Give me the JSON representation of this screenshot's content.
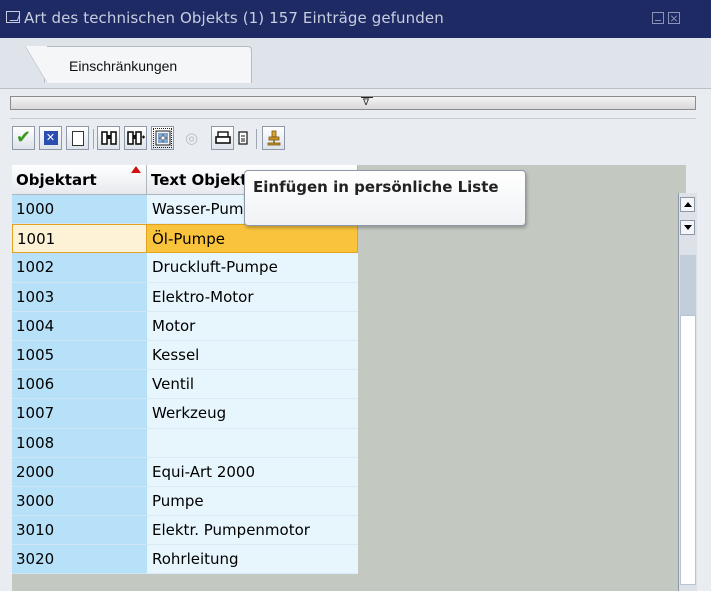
{
  "window": {
    "title": "Art des technischen Objekts (1)  157 Einträge gefunden",
    "title_icon": "window-icon",
    "minimize_icon": "minimize-icon",
    "close_icon": "close-icon"
  },
  "tabs": [
    {
      "label": "Einschränkungen",
      "active": true
    }
  ],
  "collapse_bar": {
    "icon": "collapse-arrow-icon",
    "glyph": "∇"
  },
  "toolbar": {
    "buttons": [
      {
        "name": "continue-button",
        "icon": "checkmark-icon",
        "enabled": true
      },
      {
        "name": "cancel-button",
        "icon": "cancel-x-icon",
        "enabled": true
      },
      {
        "name": "new-search-button",
        "icon": "blank-page-icon",
        "enabled": true
      },
      {
        "name": "find-button",
        "icon": "binoculars-icon",
        "enabled": true
      },
      {
        "name": "find-next-button",
        "icon": "binoculars-plus-icon",
        "enabled": true
      },
      {
        "name": "insert-personal-list-button",
        "icon": "insert-list-icon",
        "enabled": true
      },
      {
        "name": "help-button",
        "icon": "help-icon",
        "enabled": false
      },
      {
        "name": "print-button",
        "icon": "printer-icon",
        "enabled": true
      },
      {
        "name": "print-preview-button",
        "icon": "document-icon",
        "enabled": true
      },
      {
        "name": "personal-settings-button",
        "icon": "pin-icon",
        "enabled": true
      }
    ]
  },
  "tooltip": {
    "text": "Einfügen in persönliche Liste"
  },
  "table": {
    "columns": [
      {
        "label": "Objektart",
        "sorted": "ascending"
      },
      {
        "label": "Text Objektart"
      }
    ],
    "rows": [
      {
        "code": "1000",
        "text": "Wasser-Pumpe"
      },
      {
        "code": "1001",
        "text": "Öl-Pumpe",
        "selected": true
      },
      {
        "code": "1002",
        "text": "Druckluft-Pumpe"
      },
      {
        "code": "1003",
        "text": "Elektro-Motor"
      },
      {
        "code": "1004",
        "text": "Motor"
      },
      {
        "code": "1005",
        "text": "Kessel"
      },
      {
        "code": "1006",
        "text": "Ventil"
      },
      {
        "code": "1007",
        "text": "Werkzeug"
      },
      {
        "code": "1008",
        "text": ""
      },
      {
        "code": "2000",
        "text": "Equi-Art 2000"
      },
      {
        "code": "3000",
        "text": "Pumpe"
      },
      {
        "code": "3010",
        "text": "Elektr. Pumpenmotor"
      },
      {
        "code": "3020",
        "text": "Rohrleitung"
      }
    ]
  },
  "colors": {
    "title_bar": "#1e2a63",
    "key_column": "#b7e1f9",
    "text_column": "#e7f6fd",
    "selection": "#f9c33c",
    "sort_indicator": "#d01010"
  }
}
